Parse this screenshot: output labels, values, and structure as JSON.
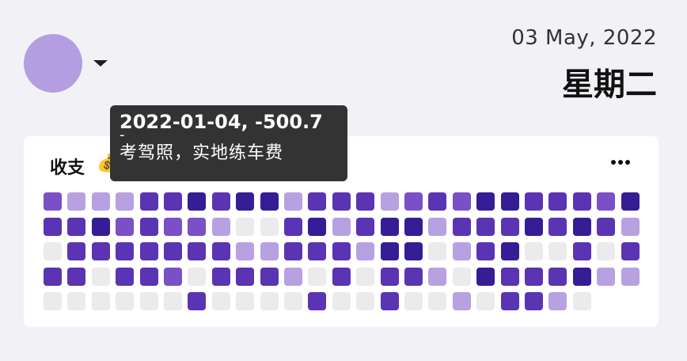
{
  "header": {
    "date": "03 May, 2022",
    "weekday": "星期二"
  },
  "card": {
    "title": "收支",
    "title_icon": "money-bag-icon",
    "menu_icon": "more-horizontal-icon"
  },
  "tooltip": {
    "head": "2022-01-04, -500.7",
    "dash": "-",
    "description": "考驾照，实地练车费"
  },
  "colors": {
    "level_0": "#ebebee",
    "level_1": "#b7a1e0",
    "level_2": "#7b4fc6",
    "level_3": "#5a34b3",
    "level_4": "#351d95",
    "avatar": "#b49de0"
  },
  "heatmap": {
    "rows": 5,
    "columns": 25,
    "levels": [
      [
        2,
        1,
        1,
        1,
        3,
        3,
        4,
        3,
        4,
        4,
        1,
        3,
        3,
        3,
        1,
        2,
        3,
        2,
        4,
        4,
        3,
        3,
        3,
        2,
        4
      ],
      [
        3,
        3,
        4,
        2,
        3,
        2,
        2,
        1,
        0,
        0,
        3,
        4,
        1,
        3,
        4,
        4,
        1,
        3,
        3,
        3,
        4,
        3,
        4,
        3,
        1
      ],
      [
        0,
        3,
        3,
        3,
        3,
        3,
        3,
        3,
        1,
        1,
        3,
        3,
        3,
        1,
        4,
        4,
        0,
        1,
        3,
        4,
        0,
        0,
        3,
        0,
        3
      ],
      [
        3,
        3,
        0,
        3,
        3,
        2,
        0,
        3,
        3,
        3,
        1,
        0,
        3,
        0,
        3,
        3,
        1,
        0,
        4,
        3,
        3,
        3,
        4,
        1,
        1
      ],
      [
        0,
        0,
        0,
        0,
        0,
        0,
        3,
        0,
        0,
        0,
        0,
        3,
        0,
        0,
        3,
        0,
        0,
        1,
        0,
        3,
        3,
        1,
        0,
        -1,
        -1
      ]
    ]
  }
}
